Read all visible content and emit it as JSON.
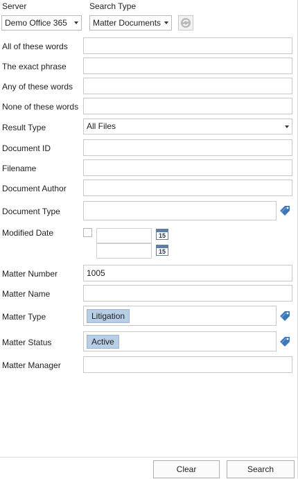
{
  "header": {
    "server_label": "Server",
    "server_value": "Demo Office 365",
    "search_type_label": "Search Type",
    "search_type_value": "Matter Documents",
    "refresh_icon": "refresh-icon"
  },
  "fields": {
    "all_words": {
      "label": "All of these words",
      "value": ""
    },
    "exact_phrase": {
      "label": "The exact phrase",
      "value": ""
    },
    "any_words": {
      "label": "Any of these words",
      "value": ""
    },
    "none_words": {
      "label": "None of these words",
      "value": ""
    },
    "result_type": {
      "label": "Result Type",
      "value": "All Files"
    },
    "document_id": {
      "label": "Document ID",
      "value": ""
    },
    "filename": {
      "label": "Filename",
      "value": ""
    },
    "document_author": {
      "label": "Document Author",
      "value": ""
    },
    "document_type": {
      "label": "Document Type",
      "value": ""
    },
    "modified_date": {
      "label": "Modified Date",
      "checked": false,
      "from": "",
      "to": "",
      "calendar_day": "15"
    },
    "matter_number": {
      "label": "Matter Number",
      "value": "1005"
    },
    "matter_name": {
      "label": "Matter Name",
      "value": ""
    },
    "matter_type": {
      "label": "Matter Type",
      "chip": "Litigation"
    },
    "matter_status": {
      "label": "Matter Status",
      "chip": "Active"
    },
    "matter_manager": {
      "label": "Matter Manager",
      "value": ""
    }
  },
  "icons": {
    "tag": "tag-icon",
    "calendar": "calendar-icon"
  },
  "colors": {
    "chip_bg": "#b8cde6",
    "tag_blue": "#3d78b8"
  },
  "footer": {
    "clear_label": "Clear",
    "search_label": "Search"
  }
}
